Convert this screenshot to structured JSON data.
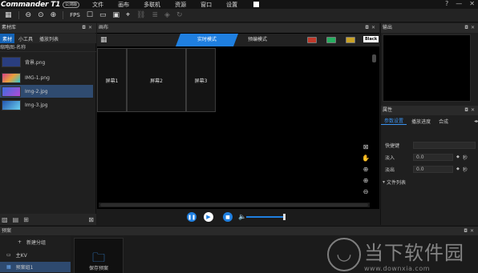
{
  "app": {
    "name": "Commander T1",
    "badge": "公测版"
  },
  "menu": [
    "文件",
    "画布",
    "多联机",
    "资源",
    "窗口",
    "设置"
  ],
  "window_controls": [
    "?",
    "—",
    "✕"
  ],
  "toolbar": {
    "fps": "FPS"
  },
  "left_panel": {
    "title": "素材库",
    "tabs": [
      "素材",
      "小工具",
      "播放列表"
    ],
    "tree_header": "缩略图-名称",
    "files": [
      {
        "name": "背景.png",
        "thumb_color": "#2a3e80"
      },
      {
        "name": "IMG-1.png",
        "thumb_color": "#d7418a"
      },
      {
        "name": "Img-2.jpg",
        "thumb_color": "#8f3fb8"
      },
      {
        "name": "Img-3.jpg",
        "thumb_color": "#3a6fd6"
      }
    ]
  },
  "canvas": {
    "title": "画布",
    "mode_live": "实时模式",
    "mode_preview": "预编模式",
    "black_label": "Black",
    "swatches": [
      "#c0392b",
      "#27ae60",
      "#c9a227"
    ],
    "screens": [
      "屏幕1",
      "屏幕2",
      "屏幕3"
    ]
  },
  "right_panel": {
    "output_title": "输出",
    "props_title": "属性",
    "tabs": [
      "参数设置",
      "播放进度",
      "合成"
    ],
    "shortcut_label": "快捷键",
    "fade_in_label": "淡入",
    "fade_in_value": "0.0",
    "fade_out_label": "淡出",
    "fade_out_value": "0.0",
    "unit": "秒",
    "file_list": "文件列表"
  },
  "bottom": {
    "title": "预案",
    "new_group": "新建分组",
    "groups": [
      "主KV",
      "预案组1"
    ],
    "save_tile": "保存预案"
  },
  "watermark": {
    "title": "当下软件园",
    "url": "www.downxia.com"
  },
  "colors": {
    "accent": "#1f7fe0",
    "selection": "#2f4b70"
  }
}
